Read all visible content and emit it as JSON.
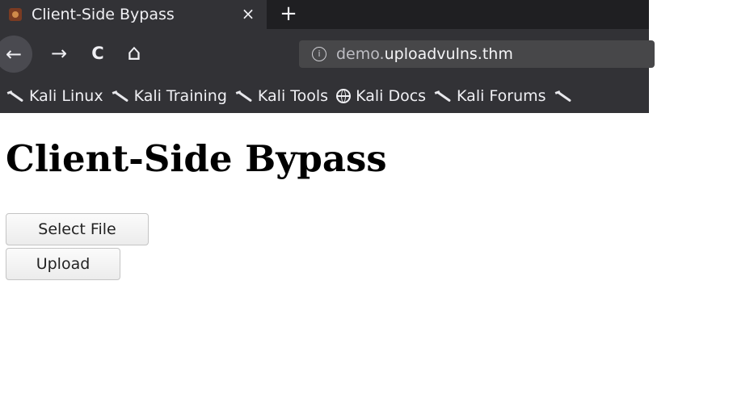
{
  "browser": {
    "tab": {
      "title": "Client-Side Bypass",
      "close_glyph": "×",
      "favicon": "site-favicon"
    },
    "new_tab_glyph": "+",
    "nav": {
      "back_glyph": "←",
      "forward_glyph": "→",
      "reload_glyph": "C",
      "home_glyph": "⌂"
    },
    "url": {
      "info_glyph": "i",
      "prefix": "demo.",
      "host": "uploadvulns.thm"
    },
    "bookmarks": [
      {
        "label": "Kali Linux",
        "icon": "kali-dragon-icon"
      },
      {
        "label": "Kali Training",
        "icon": "kali-dragon-icon"
      },
      {
        "label": "Kali Tools",
        "icon": "kali-dragon-icon"
      },
      {
        "label": "Kali Docs",
        "icon": "globe-icon"
      },
      {
        "label": "Kali Forums",
        "icon": "kali-dragon-icon"
      }
    ]
  },
  "page": {
    "title": "Client-Side Bypass",
    "select_button": "Select File",
    "upload_button": "Upload"
  }
}
